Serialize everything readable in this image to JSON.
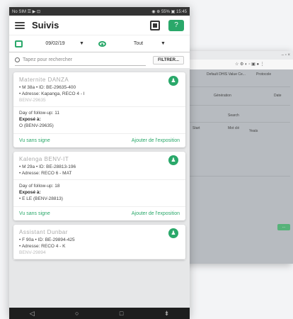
{
  "background_window": {
    "titlebar_controls": "–  ▫  ×",
    "toolbar_text": "☆ ⚙ ◐ ▫ ▣ ● ⋮",
    "labels": [
      "Default DHIS Value Ce...",
      "Protocole",
      "Génération",
      "Date",
      "Search",
      "Start",
      "Mot clé",
      "Yeats"
    ],
    "button": "..."
  },
  "status_bar": {
    "left": "No SIM ☰ ▶ ⊡",
    "right": "◉ ⊕ 55% ▣ 15:45"
  },
  "app_bar": {
    "title": "Suivis",
    "help_label": "?"
  },
  "filters": {
    "date": "09/02/19",
    "type": "Tout"
  },
  "search": {
    "placeholder": "Tapez pour rechercher",
    "filter_button": "FILTRER..."
  },
  "cards": [
    {
      "name": "Maternite DANZA",
      "info": "• M 38a  • ID: BE-29635-400",
      "address": "• Adresse: Kapanga, RECO 4 - I",
      "extra": "BENV-29635",
      "day": "Day of follow-up: 11",
      "expose_label": "Exposé à:",
      "expose_value": "O  (BENV-29635)",
      "action_left": "Vu sans signe",
      "action_right": "Ajouter de l'exposition"
    },
    {
      "name": "Kalenga BENV-IT",
      "info": "• M 29a  • ID: BE-28813-196",
      "address": "• Adresse: RECO 6 - MAT",
      "extra": "",
      "day": "Day of follow-up: 18",
      "expose_label": "Exposé à:",
      "expose_value": "• E          LE  (BENV-28813)",
      "action_left": "Vu sans signe",
      "action_right": "Ajouter de l'exposition"
    },
    {
      "name": "Assistant Dunbar",
      "info": "• F 90a  • ID: BE-29894-425",
      "address": "• Adresse: RECO 4 - K",
      "extra": "BENV-29894",
      "day": "",
      "expose_label": "",
      "expose_value": "",
      "action_left": "",
      "action_right": ""
    }
  ],
  "nav": {
    "back": "◁",
    "home": "○",
    "recent": "□",
    "menu": "⇟"
  },
  "colors": {
    "accent": "#2aa86a",
    "status_bar": "#333333",
    "nav_bar": "#1e1e1e"
  },
  "icons": [
    "menu-icon",
    "scan-icon",
    "help-icon",
    "calendar-icon",
    "chevron-down-icon",
    "eye-icon",
    "search-icon",
    "avatar-icon"
  ]
}
